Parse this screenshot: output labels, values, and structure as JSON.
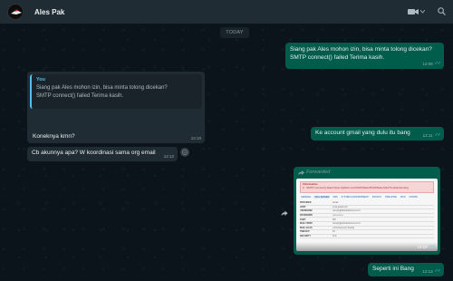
{
  "header": {
    "contact_name": "Ales Pak",
    "icons": [
      "avatar-icon",
      "video-call-icon",
      "chevron-down-icon",
      "search-icon"
    ]
  },
  "chat": {
    "date_label": "TODAY",
    "messages": [
      {
        "direction": "out",
        "text_lines": [
          "Siang pak Ales mohon izin, bisa minta tolong dicekan?",
          "SMTP connect() failed Terima kasih."
        ],
        "time": "12:09"
      },
      {
        "direction": "in",
        "quote": {
          "author": "You",
          "lines": [
            "Siang pak Ales mohon izin, bisa minta tolong dicekan?",
            "SMTP connect() failed Terima kasih."
          ]
        },
        "text": "Koneknya kmn?",
        "time": "12:10"
      },
      {
        "direction": "out",
        "text": "Ke account gmail yang dulu itu bang",
        "time": "12:11"
      },
      {
        "direction": "in",
        "text": "Cb akunnya apa? W koordinasi sama org email",
        "time": "12:12"
      },
      {
        "direction": "out",
        "forwarded_label": "Forwarded",
        "time": "12:12",
        "image": {
          "alert_title": "Information",
          "alert_text": "2 : SMTP connect() failed https://github.com/PHPMailer/PHPMailer/wiki/Troubleshooting",
          "tabs": [
            "GENERAL",
            "MAIL SERVER",
            "SMS",
            "SYSTEM & ENVIRONMENT",
            "BACKUP",
            "TIME ZONE",
            "SKIN",
            "UPDATE"
          ],
          "rows": [
            {
              "k": "PROVIDER",
              "v": "Gmail"
            },
            {
              "k": "HOST",
              "v": "smtp.gmail.com"
            },
            {
              "k": "USERNAME",
              "v": "noreply@domainkomet.co.id"
            },
            {
              "k": "PASSWORD",
              "v": "••••••••••••••"
            },
            {
              "k": "PORT",
              "v": "587"
            },
            {
              "k": "MAIL FROM",
              "v": "noreply@domainkomet.co.id"
            },
            {
              "k": "MAIL ALIAS",
              "v": "e-Procurement Testing"
            },
            {
              "k": "TIMEOUT",
              "v": "15"
            },
            {
              "k": "SECURITY",
              "v": "TLS"
            }
          ]
        }
      },
      {
        "direction": "out",
        "text": "Seperti ini Bang",
        "time": "12:13"
      }
    ]
  },
  "colors": {
    "background": "#0b141a",
    "header": "#202c33",
    "outgoing_bubble": "#005c4b",
    "incoming_bubble": "#202c33",
    "read_ticks": "#53bdeb"
  }
}
